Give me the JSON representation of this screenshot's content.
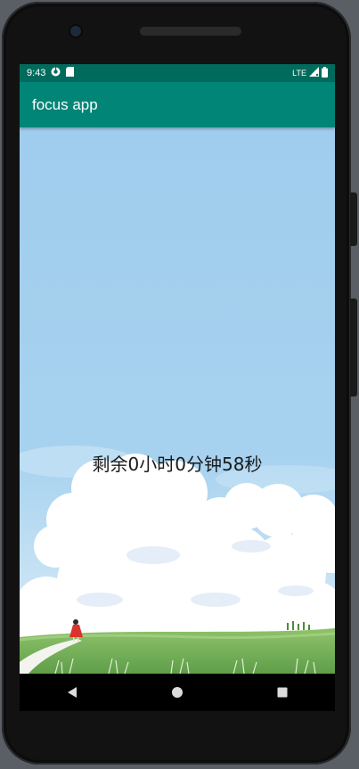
{
  "status_bar": {
    "time": "9:43",
    "network": "LTE"
  },
  "app_bar": {
    "title": "focus app"
  },
  "main": {
    "countdown_text": "剩余0小时0分钟58秒"
  },
  "nav_bar": {
    "back_icon": "triangle-back-icon",
    "home_icon": "circle-home-icon",
    "recents_icon": "square-recents-icon"
  },
  "colors": {
    "status_bar": "#006b5c",
    "app_bar": "#008577",
    "sky": "#a3cfee"
  }
}
